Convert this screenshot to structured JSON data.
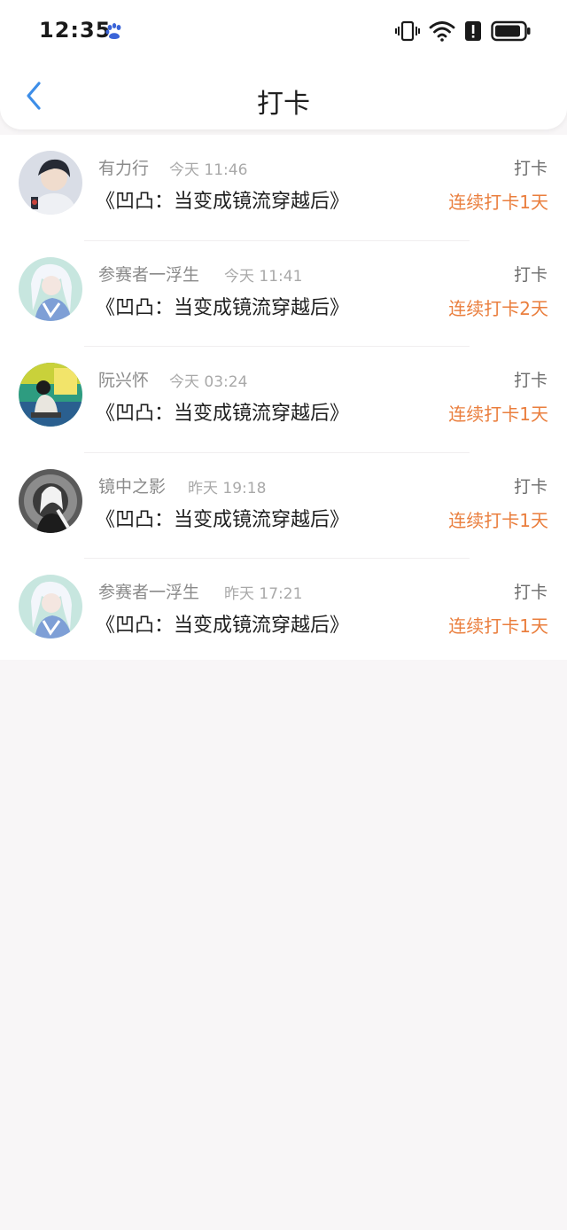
{
  "status_bar": {
    "time": "12:35",
    "icons": [
      "baidu-paw-icon",
      "vibrate-icon",
      "wifi-icon",
      "alert-icon",
      "battery-icon"
    ]
  },
  "nav": {
    "back_icon": "chevron-left-icon",
    "title": "打卡"
  },
  "colors": {
    "accent_blue": "#3d8ee8",
    "streak_orange": "#ea7e3d",
    "background": "#f8f6f7"
  },
  "checkins": [
    {
      "name": "有力行",
      "time": "今天 11:46",
      "book": "《凹凸：当变成镜流穿越后》",
      "action": "打卡",
      "streak": "连续打卡1天"
    },
    {
      "name": "参赛者一浮生",
      "time": "今天 11:41",
      "book": "《凹凸：当变成镜流穿越后》",
      "action": "打卡",
      "streak": "连续打卡2天"
    },
    {
      "name": "阮兴怀",
      "time": "今天 03:24",
      "book": "《凹凸：当变成镜流穿越后》",
      "action": "打卡",
      "streak": "连续打卡1天"
    },
    {
      "name": "镜中之影",
      "time": "昨天 19:18",
      "book": "《凹凸：当变成镜流穿越后》",
      "action": "打卡",
      "streak": "连续打卡1天"
    },
    {
      "name": "参赛者一浮生",
      "time": "昨天 17:21",
      "book": "《凹凸：当变成镜流穿越后》",
      "action": "打卡",
      "streak": "连续打卡1天"
    }
  ]
}
